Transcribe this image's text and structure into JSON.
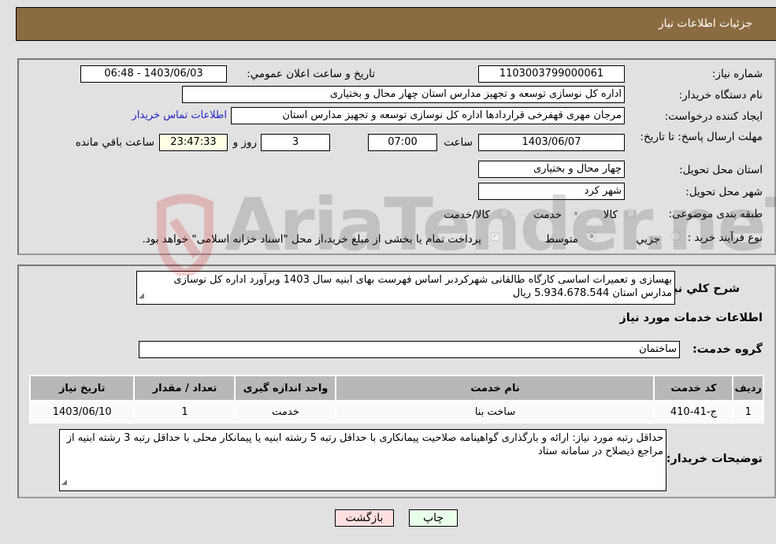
{
  "header": {
    "title": "جزئیات اطلاعات نیاز"
  },
  "form": {
    "need_number": {
      "label": "شماره نیاز:",
      "value": "1103003799000061"
    },
    "announce_datetime": {
      "label": "تاریخ و ساعت اعلان عمومي:",
      "value": "1403/06/03 - 06:48"
    },
    "buyer_org": {
      "label": "نام دستگاه خریدار:",
      "value": "اداره کل نوسازی  توسعه و تجهیز مدارس استان چهار محال و بختیاری"
    },
    "requester": {
      "label": "ایجاد کننده درخواست:",
      "value": "مرجان مهری قهفرخی قراردادها اداره کل نوسازی  توسعه و تجهیز مدارس استان",
      "contact_link": "اطلاعات تماس خریدار"
    },
    "deadline": {
      "label": "مهلت ارسال پاسخ: تا تاریخ:",
      "date": "1403/06/07",
      "time_label": "ساعت",
      "time": "07:00",
      "days": "3",
      "days_label": "روز و",
      "remaining": "23:47:33",
      "remaining_label": "ساعت باقي مانده"
    },
    "delivery_province": {
      "label": "استان محل تحویل:",
      "value": "چهار محال و بختیاری"
    },
    "delivery_city": {
      "label": "شهر محل تحویل:",
      "value": "شهر کرد"
    },
    "category": {
      "label": "طبقه بندی موضوعی:",
      "options": [
        "کالا",
        "خدمت",
        "کالا/خدمت"
      ],
      "selected": "خدمت"
    },
    "purchase_type": {
      "label": "نوع فرآیند خرید :",
      "options": [
        "جزيي",
        "متوسط"
      ],
      "selected": "متوسط",
      "treasury_note": "پرداخت تمام یا بخشی از مبلغ خرید،از محل \"اسناد خزانه اسلامی\" خواهد بود."
    }
  },
  "details": {
    "description_label": "شرح کلي نیاز:",
    "description": "بهسازی و تعمیرات اساسی کارگاه طالقانی شهرکردبر اساس فهرست بهای ابنیه سال 1403 وبرآورد اداره کل نوسازی مدارس استان 5.934.678.544 ریال",
    "services_heading": "اطلاعات خدمات مورد نیاز",
    "service_group_label": "گروه خدمت:",
    "service_group": "ساختمان",
    "table": {
      "headers": [
        "ردیف",
        "کد خدمت",
        "نام خدمت",
        "واحد اندازه گیری",
        "تعداد / مقدار",
        "تاریخ نیاز"
      ],
      "rows": [
        [
          "1",
          "ج-41-410",
          "ساخت بنا",
          "خدمت",
          "1",
          "1403/06/10"
        ]
      ]
    },
    "buyer_notes_label": "توضیحات خریدار:",
    "buyer_notes": "حداقل رتبه مورد نیاز: ارائه و بارگذاری گواهینامه صلاحیت پیمانکاری با حداقل رتبه 5 رشته ابنیه یا پیمانکار محلی با حداقل رتبه 3 رشته ابنیه از مراجع ذیصلاح در سامانه ستاد"
  },
  "buttons": {
    "print": "چاپ",
    "back": "بازگشت"
  },
  "colors": {
    "header_bg": "#8b6b41",
    "print_bg": "#eaffea",
    "back_bg": "#ffe0e0",
    "link": "#2222cc"
  },
  "watermark": "AriaTender.neT"
}
